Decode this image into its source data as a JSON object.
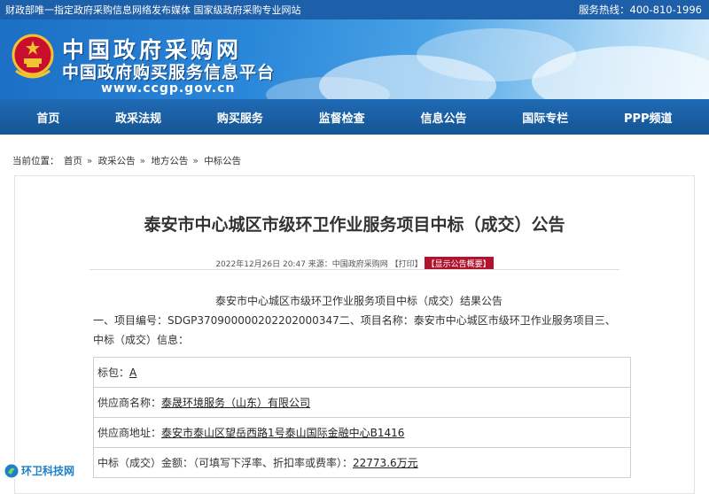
{
  "topbar": {
    "left": "财政部唯一指定政府采购信息网络发布媒体 国家级政府采购专业网站",
    "right": "服务热线：400-810-1996"
  },
  "banner": {
    "title": "中国政府采购网",
    "subtitle": "中国政府购买服务信息平台",
    "url": "www.ccgp.gov.cn"
  },
  "nav": {
    "items": [
      "首页",
      "政采法规",
      "购买服务",
      "监督检查",
      "信息公告",
      "国际专栏",
      "PPP频道"
    ]
  },
  "breadcrumb": {
    "label": "当前位置：",
    "items": [
      "首页",
      "政采公告",
      "地方公告",
      "中标公告"
    ]
  },
  "article": {
    "title": "泰安市中心城区市级环卫作业服务项目中标（成交）公告",
    "meta": "2022年12月26日 20:47 来源：中国政府采购网 【打印】",
    "meta_badge": "【显示公告概要】",
    "heading": "泰安市中心城区市级环卫作业服务项目中标（成交）结果公告",
    "para_line1": "一、项目编号：SDGP370900000202202000347二、项目名称：泰安市中心城区市级环卫作业服务项目三、",
    "para_line2": "中标（成交）信息：",
    "rows": [
      {
        "label": "标包：",
        "value": "A"
      },
      {
        "label": "供应商名称：",
        "value": "泰晟环境服务（山东）有限公司"
      },
      {
        "label": "供应商地址：",
        "value": "泰安市泰山区望岳西路1号泰山国际金融中心B1416"
      },
      {
        "label": "中标（成交）金额：（可填写下浮率、折扣率或费率）：",
        "value": "22773.6万元"
      }
    ]
  },
  "watermark": {
    "text": "环卫科技网"
  }
}
